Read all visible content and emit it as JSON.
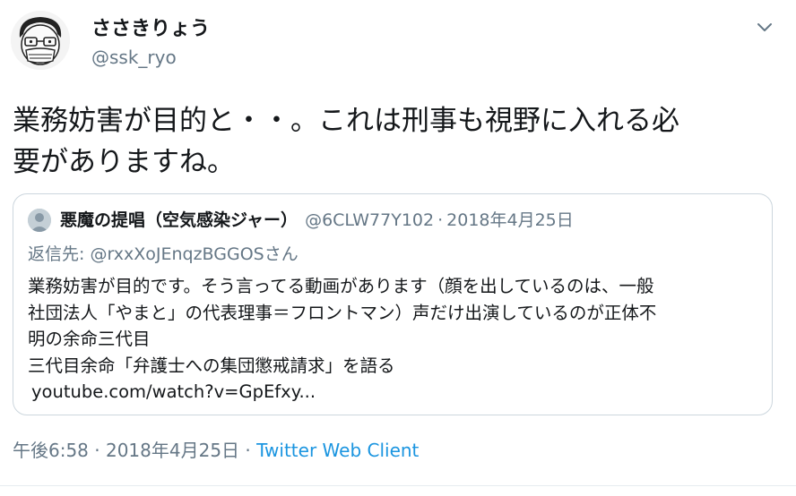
{
  "tweet": {
    "display_name": "ささきりょう",
    "handle": "@ssk_ryo",
    "text": "業務妨害が目的と・・。これは刑事も視野に入れる必\n要がありますね。",
    "timestamp": "午後6:58 · 2018年4月25日",
    "separator": " · ",
    "client": "Twitter Web Client"
  },
  "quote": {
    "name": "悪魔の提唱（空気感染ジャー）",
    "handle": "@6CLW77Y102",
    "separator": "·",
    "date": "2018年4月25日",
    "reply_to": "返信先: @rxxXoJEnqzBGGOSさん",
    "lines": [
      "業務妨害が目的です。そう言ってる動画があります（顔を出しているのは、一般",
      "社団法人「やまと」の代表理事＝フロントマン）声だけ出演しているのが正体不",
      "明の余命三代目",
      "三代目余命「弁護士への集団懲戒請求」を語る"
    ],
    "link": "youtube.com/watch?v=GpEfxy..."
  },
  "icons": {
    "caret": "chevron-down-icon",
    "avatar": "cartoon-face-avatar",
    "quote_avatar": "default-avatar"
  },
  "colors": {
    "text": "#14171a",
    "secondary": "#657786",
    "link": "#1b95e0",
    "border": "#ccd6dd"
  }
}
